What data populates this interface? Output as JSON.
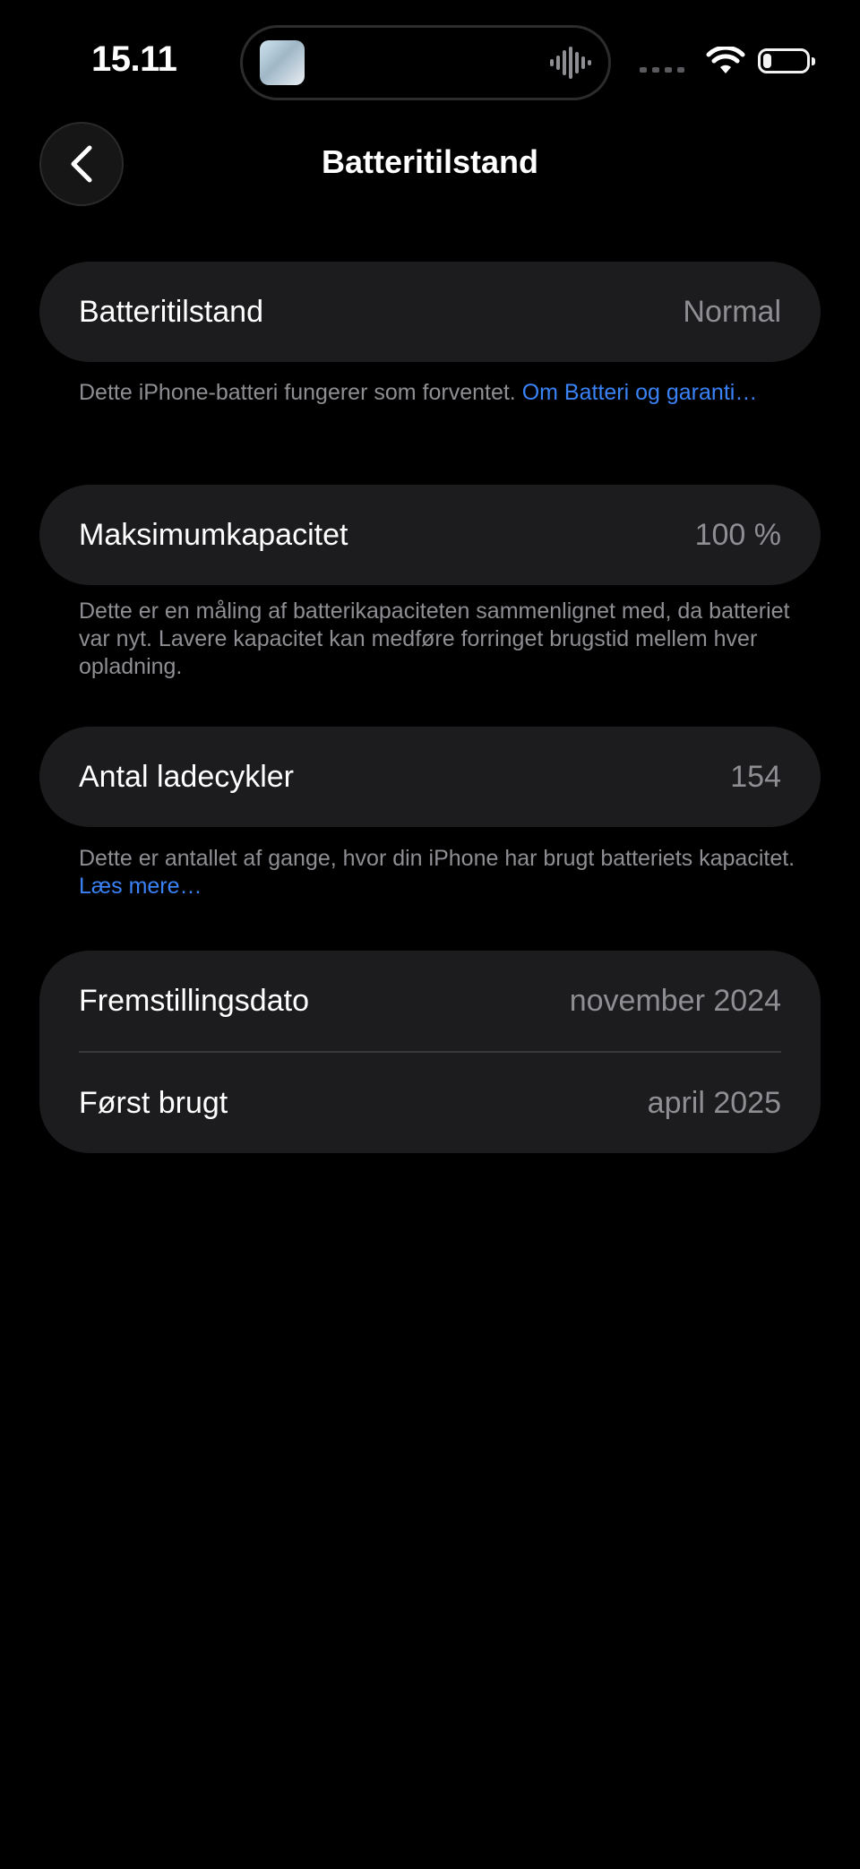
{
  "status_bar": {
    "time": "15.11"
  },
  "nav": {
    "title": "Batteritilstand"
  },
  "sections": {
    "health": {
      "label": "Batteritilstand",
      "value": "Normal",
      "footnote": "Dette iPhone-batteri fungerer som forventet. ",
      "footnote_link": "Om Batteri og garanti…"
    },
    "capacity": {
      "label": "Maksimumkapacitet",
      "value": "100 %",
      "footnote": "Dette er en måling af batterikapaciteten sammenlignet med, da batteriet var nyt. Lavere kapacitet kan medføre forringet brugstid mellem hver opladning."
    },
    "cycles": {
      "label": "Antal ladecykler",
      "value": "154",
      "footnote": "Dette er antallet af gange, hvor din iPhone har brugt batteriets kapacitet. ",
      "footnote_link": "Læs mere…"
    },
    "dates": {
      "manufacture_label": "Fremstillingsdato",
      "manufacture_value": "november 2024",
      "first_use_label": "Først brugt",
      "first_use_value": "april 2025"
    }
  },
  "colors": {
    "background": "#000000",
    "card": "#1c1c1e",
    "secondary_text": "#8e8e93",
    "link": "#3a82f7"
  },
  "icons": {
    "back": "chevron-left-icon",
    "wifi": "wifi-icon",
    "battery": "battery-icon",
    "waveform": "waveform-icon"
  },
  "battery_level": 0.2
}
